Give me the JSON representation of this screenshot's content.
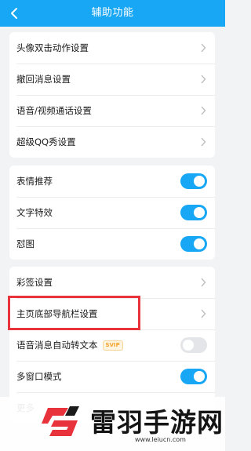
{
  "header": {
    "title": "辅助功能"
  },
  "group1": [
    {
      "label": "头像双击动作设置"
    },
    {
      "label": "撤回消息设置"
    },
    {
      "label": "语音/视频通话设置"
    },
    {
      "label": "超级QQ秀设置"
    }
  ],
  "group2": [
    {
      "label": "表情推荐",
      "enabled": true
    },
    {
      "label": "文字特效",
      "enabled": true
    },
    {
      "label": "怼图",
      "enabled": true
    }
  ],
  "group3": [
    {
      "label": "彩签设置"
    },
    {
      "label": "主页底部导航栏设置"
    },
    {
      "label": "语音消息自动转文本",
      "badge": "SVIP",
      "enabled": false
    },
    {
      "label": "多窗口模式",
      "enabled": true
    },
    {
      "label": "更多"
    }
  ],
  "watermark": {
    "text": "雷羽手游网",
    "url": "www.leiucn.com"
  },
  "colors": {
    "accent": "#18a7f5",
    "highlight": "#e8323c",
    "background": "#f2f3f5"
  }
}
